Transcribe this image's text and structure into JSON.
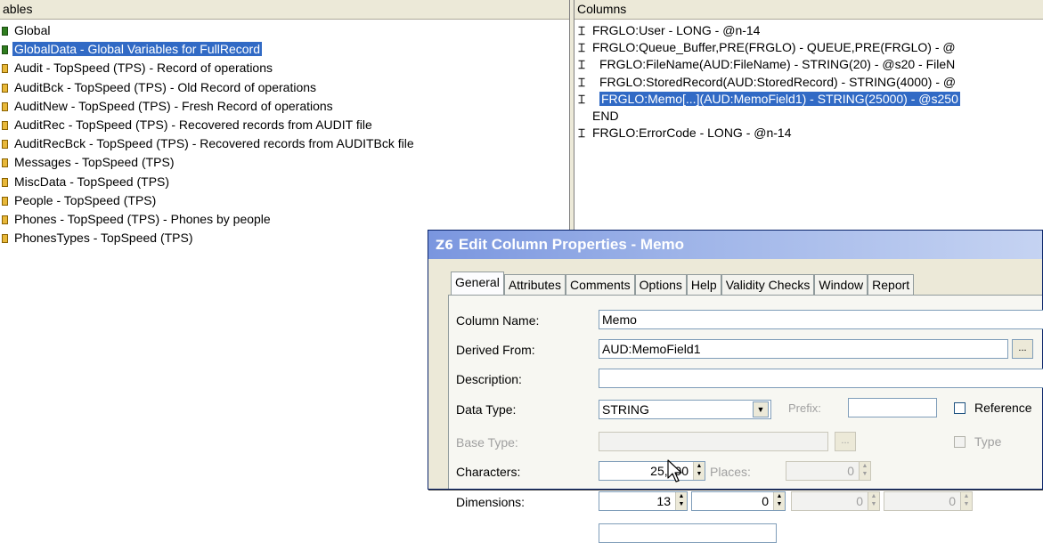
{
  "left_panel": {
    "header": "ables",
    "items": [
      {
        "label": "Global",
        "icon": "green"
      },
      {
        "label": "GlobalData - Global Variables for FullRecord",
        "icon": "green",
        "selected": true
      },
      {
        "label": "Audit - TopSpeed (TPS) - Record of operations",
        "icon": "yellow"
      },
      {
        "label": "AuditBck - TopSpeed (TPS) - Old Record of operations",
        "icon": "yellow"
      },
      {
        "label": "AuditNew - TopSpeed (TPS) - Fresh Record of operations",
        "icon": "yellow"
      },
      {
        "label": "AuditRec - TopSpeed (TPS) - Recovered records from AUDIT file",
        "icon": "yellow"
      },
      {
        "label": "AuditRecBck - TopSpeed (TPS) - Recovered records from AUDITBck file",
        "icon": "yellow"
      },
      {
        "label": "Messages - TopSpeed (TPS)",
        "icon": "yellow"
      },
      {
        "label": "MiscData - TopSpeed (TPS)",
        "icon": "yellow"
      },
      {
        "label": "People - TopSpeed (TPS)",
        "icon": "yellow"
      },
      {
        "label": "Phones - TopSpeed (TPS) - Phones by people",
        "icon": "yellow"
      },
      {
        "label": "PhonesTypes - TopSpeed (TPS)",
        "icon": "yellow"
      }
    ]
  },
  "right_panel": {
    "header": "Columns",
    "items": [
      {
        "label": "FRGLO:User - LONG - @n-14",
        "indent": 0
      },
      {
        "label": "FRGLO:Queue_Buffer,PRE(FRGLO) - QUEUE,PRE(FRGLO) - @",
        "indent": 0
      },
      {
        "label": "FRGLO:FileName(AUD:FileName) - STRING(20) - @s20 - FileN",
        "indent": 1
      },
      {
        "label": "FRGLO:StoredRecord(AUD:StoredRecord) - STRING(4000) - @",
        "indent": 1
      },
      {
        "label": "FRGLO:Memo[...](AUD:MemoField1) - STRING(25000) - @s250",
        "indent": 1,
        "selected": true
      },
      {
        "label": "END",
        "indent": 0,
        "no_icon": true
      },
      {
        "label": "FRGLO:ErrorCode - LONG - @n-14",
        "indent": 0
      }
    ]
  },
  "dialog": {
    "title": "Edit Column Properties - Memo",
    "app_icon_text": "Z6",
    "tabs": [
      "General",
      "Attributes",
      "Comments",
      "Options",
      "Help",
      "Validity Checks",
      "Window",
      "Report"
    ],
    "fields": {
      "column_name": {
        "label": "Column Name:",
        "value": "Memo"
      },
      "derived_from": {
        "label": "Derived From:",
        "value": "AUD:MemoField1",
        "button": "..."
      },
      "description": {
        "label": "Description:",
        "value": ""
      },
      "data_type": {
        "label": "Data Type:",
        "value": "STRING"
      },
      "prefix": {
        "label": "Prefix:",
        "value": ""
      },
      "reference": {
        "label": "Reference"
      },
      "base_type": {
        "label": "Base Type:",
        "value": "",
        "button": "..."
      },
      "type": {
        "label": "Type"
      },
      "characters": {
        "label": "Characters:",
        "value": "25,000"
      },
      "places": {
        "label": "Places:",
        "value": "0"
      },
      "dimensions": {
        "label": "Dimensions:",
        "values": [
          "13",
          "0",
          "0",
          "0"
        ]
      }
    }
  },
  "colors": {
    "selection": "#316ac5",
    "title_gradient_start": "#7a96df",
    "dialog_bg": "#ece9d8"
  }
}
